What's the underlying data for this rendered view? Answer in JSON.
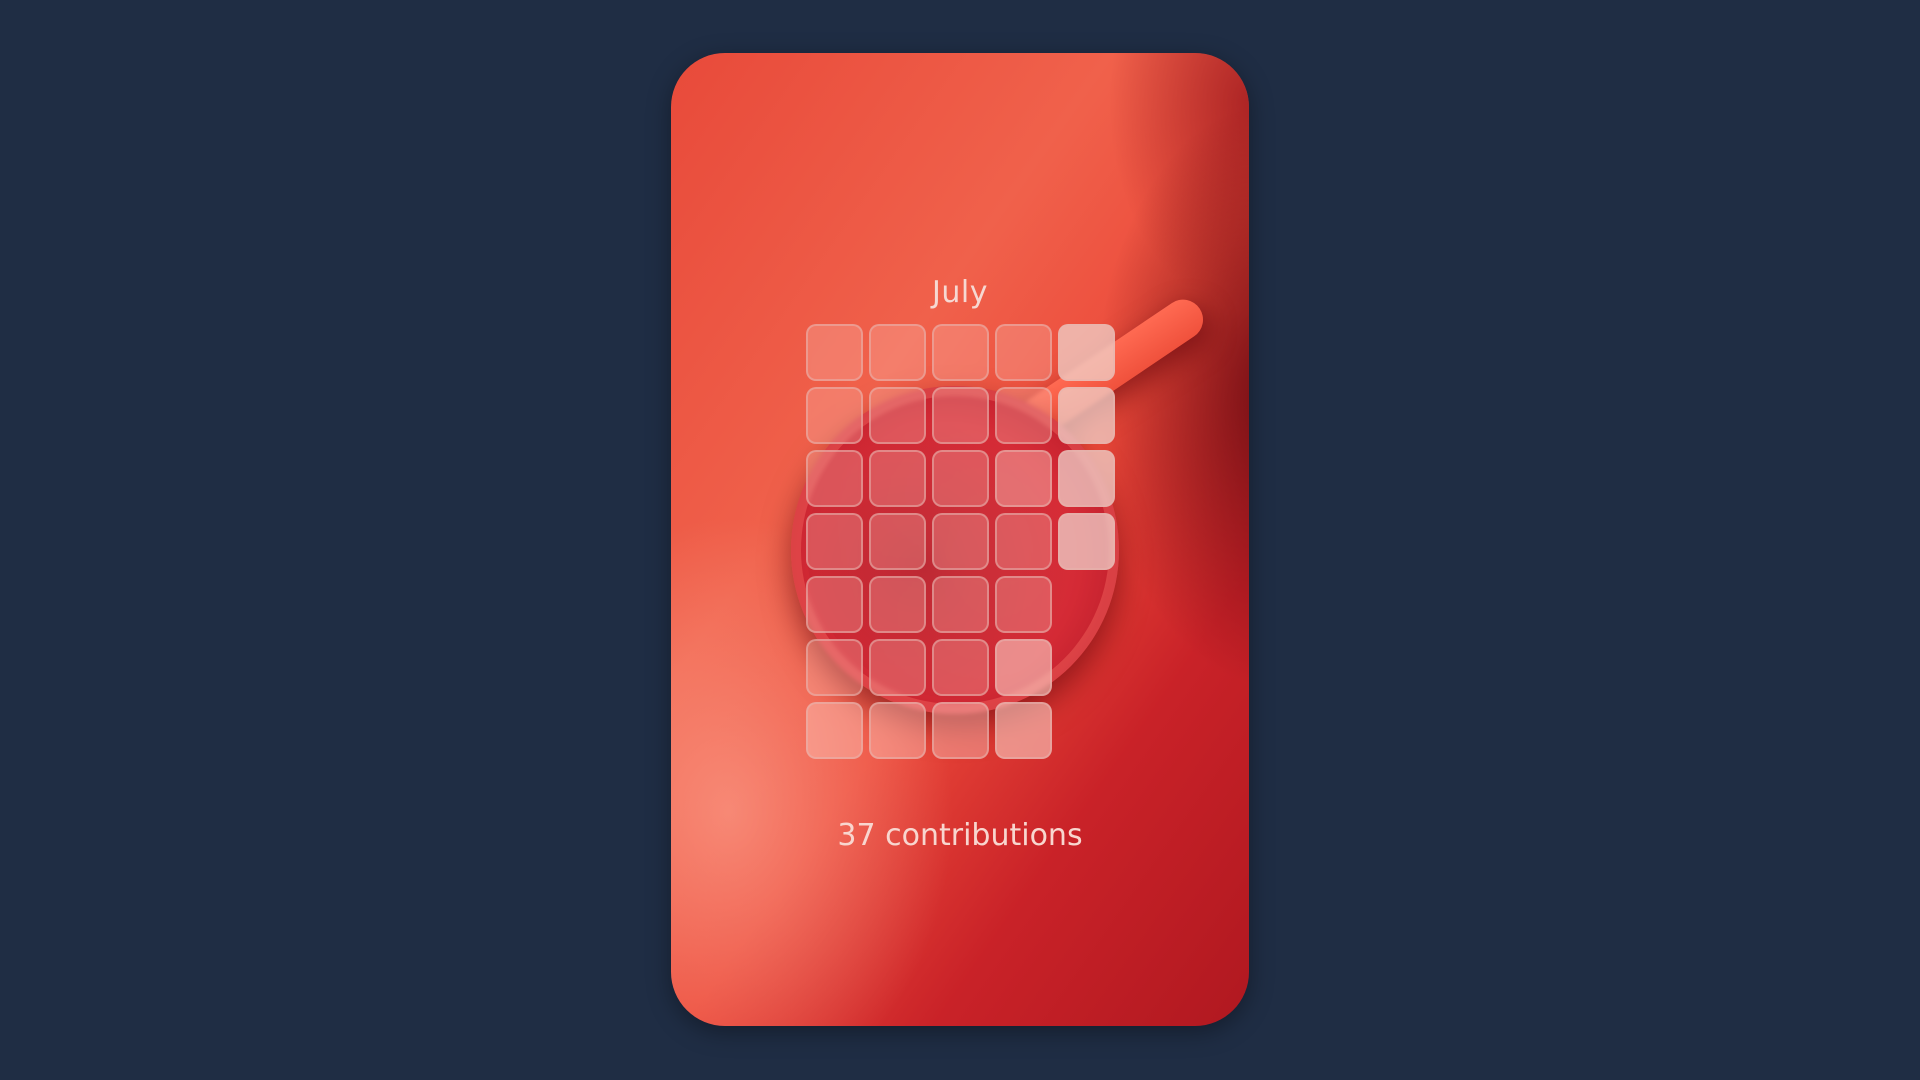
{
  "card": {
    "month": "July",
    "contributions_label": "37 contributions"
  },
  "calendar": {
    "columns": 5,
    "rows": 7,
    "levels": [
      [
        1,
        1,
        1,
        1,
        4
      ],
      [
        1,
        1,
        1,
        1,
        4
      ],
      [
        1,
        1,
        1,
        2,
        4
      ],
      [
        1,
        1,
        1,
        1,
        4
      ],
      [
        1,
        1,
        1,
        1,
        null
      ],
      [
        1,
        1,
        1,
        3,
        null
      ],
      [
        2,
        2,
        2,
        3,
        null
      ]
    ]
  },
  "colors": {
    "background": "#1f2d44",
    "card_accent": "#e84a3a",
    "text": "#f6d8d2"
  }
}
